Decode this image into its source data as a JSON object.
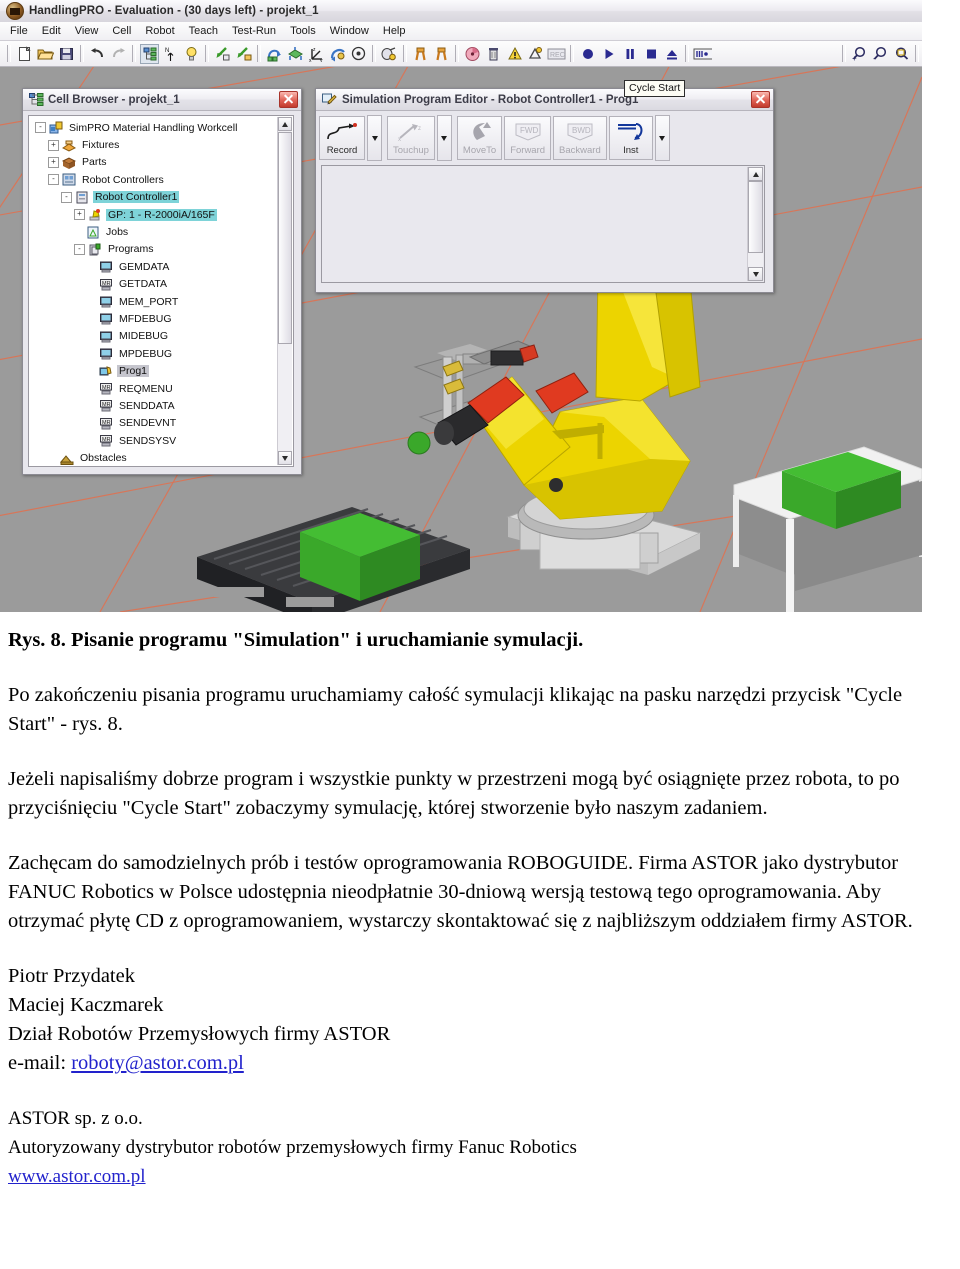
{
  "app": {
    "title": "HandlingPRO - Evaluation - (30 days left) - projekt_1",
    "app_icon": "handlingpro-logo-icon",
    "menu": [
      "File",
      "Edit",
      "View",
      "Cell",
      "Robot",
      "Teach",
      "Test-Run",
      "Tools",
      "Window",
      "Help"
    ],
    "toolbar": {
      "groups": [
        {
          "buttons": [
            {
              "name": "new-icon",
              "glyph": "page"
            },
            {
              "name": "open-icon",
              "glyph": "folder"
            },
            {
              "name": "save-icon",
              "glyph": "floppy"
            }
          ]
        },
        {
          "buttons": [
            {
              "name": "undo-icon",
              "glyph": "undo"
            },
            {
              "name": "redo-icon",
              "glyph": "redo"
            }
          ]
        },
        {
          "buttons": [
            {
              "name": "cell-browser-icon",
              "glyph": "tree",
              "active": true
            },
            {
              "name": "navigator-icon",
              "glyph": "north"
            },
            {
              "name": "hint-icon",
              "glyph": "bulb"
            }
          ]
        },
        {
          "buttons": [
            {
              "name": "teach-tool-icon",
              "glyph": "arrow-green-lock"
            },
            {
              "name": "teach-user-icon",
              "glyph": "arrow-green-user"
            }
          ]
        },
        {
          "buttons": [
            {
              "name": "jog-coord-icon",
              "glyph": "jog"
            },
            {
              "name": "world-frame-icon",
              "glyph": "frame"
            },
            {
              "name": "axis-frame-icon",
              "glyph": "axes"
            },
            {
              "name": "tool-frame-icon",
              "glyph": "toolframe"
            },
            {
              "name": "target-icon",
              "glyph": "target"
            }
          ]
        },
        {
          "buttons": [
            {
              "name": "teach-pendant-icon",
              "glyph": "pendant"
            }
          ]
        },
        {
          "buttons": [
            {
              "name": "gripper-icon",
              "glyph": "gripper"
            },
            {
              "name": "gripper2-icon",
              "glyph": "gripper2"
            }
          ]
        },
        {
          "buttons": [
            {
              "name": "profiler-icon",
              "glyph": "profiler"
            },
            {
              "name": "trash-icon",
              "glyph": "trash"
            },
            {
              "name": "alarm-icon",
              "glyph": "alarm"
            },
            {
              "name": "collision-icon",
              "glyph": "collision"
            },
            {
              "name": "record-display-icon",
              "glyph": "reclabel"
            }
          ]
        },
        {
          "buttons": [
            {
              "name": "record-button-icon",
              "glyph": "record"
            },
            {
              "name": "cycle-start-icon",
              "glyph": "play"
            },
            {
              "name": "pause-icon",
              "glyph": "pause"
            },
            {
              "name": "stop-icon",
              "glyph": "stop"
            },
            {
              "name": "eject-icon",
              "glyph": "eject"
            }
          ]
        },
        {
          "buttons": [
            {
              "name": "timeline-icon",
              "glyph": "timeline"
            }
          ]
        },
        {
          "buttons": [
            {
              "name": "zoom-in-icon",
              "glyph": "zoomin"
            },
            {
              "name": "zoom-out-icon",
              "glyph": "zoomout"
            },
            {
              "name": "zoom-window-icon",
              "glyph": "zoomwin"
            }
          ]
        }
      ]
    },
    "tooltip": "Cycle Start"
  },
  "cell_browser": {
    "title": "Cell Browser - projekt_1",
    "title_icon": "cell-browser-icon",
    "close_label": "Close",
    "tree": [
      {
        "label": "SimPRO Material Handling Workcell",
        "indent": 0,
        "expander": "-",
        "icon": "workcell-icon",
        "state": "none"
      },
      {
        "label": "Fixtures",
        "indent": 1,
        "expander": "+",
        "icon": "fixtures-icon",
        "state": "none"
      },
      {
        "label": "Parts",
        "indent": 1,
        "expander": "+",
        "icon": "parts-icon",
        "state": "none"
      },
      {
        "label": "Robot Controllers",
        "indent": 1,
        "expander": "-",
        "icon": "controllers-icon",
        "state": "none"
      },
      {
        "label": "Robot Controller1",
        "indent": 2,
        "expander": "-",
        "icon": "controller-icon",
        "state": "selected"
      },
      {
        "label": "GP: 1 - R-2000iA/165F",
        "indent": 3,
        "expander": "+",
        "icon": "robot-icon",
        "state": "selected"
      },
      {
        "label": "Jobs",
        "indent": 3,
        "expander": "",
        "icon": "jobs-icon",
        "state": "none"
      },
      {
        "label": "Programs",
        "indent": 3,
        "expander": "-",
        "icon": "programs-icon",
        "state": "none"
      },
      {
        "label": "GEMDATA",
        "indent": 4,
        "expander": "",
        "icon": "program-icon",
        "state": "none"
      },
      {
        "label": "GETDATA",
        "indent": 4,
        "expander": "",
        "icon": "mr-program-icon",
        "state": "none"
      },
      {
        "label": "MEM_PORT",
        "indent": 4,
        "expander": "",
        "icon": "program-icon",
        "state": "none"
      },
      {
        "label": "MFDEBUG",
        "indent": 4,
        "expander": "",
        "icon": "program-icon",
        "state": "none"
      },
      {
        "label": "MIDEBUG",
        "indent": 4,
        "expander": "",
        "icon": "program-icon",
        "state": "none"
      },
      {
        "label": "MPDEBUG",
        "indent": 4,
        "expander": "",
        "icon": "program-icon",
        "state": "none"
      },
      {
        "label": "Prog1",
        "indent": 4,
        "expander": "",
        "icon": "sim-program-icon",
        "state": "focused"
      },
      {
        "label": "REQMENU",
        "indent": 4,
        "expander": "",
        "icon": "mr-program-icon",
        "state": "none"
      },
      {
        "label": "SENDDATA",
        "indent": 4,
        "expander": "",
        "icon": "mr-program-icon",
        "state": "none"
      },
      {
        "label": "SENDEVNT",
        "indent": 4,
        "expander": "",
        "icon": "mr-program-icon",
        "state": "none"
      },
      {
        "label": "SENDSYSV",
        "indent": 4,
        "expander": "",
        "icon": "mr-program-icon",
        "state": "none"
      },
      {
        "label": "Obstacles",
        "indent": 1,
        "expander": "",
        "icon": "obstacles-icon",
        "state": "none"
      }
    ]
  },
  "program_editor": {
    "title": "Simulation Program Editor - Robot Controller1 - Prog1",
    "title_icon": "program-editor-icon",
    "buttons": [
      {
        "label": "Record",
        "icon": "record-point-icon",
        "enabled": true,
        "dropdown": true
      },
      {
        "label": "Touchup",
        "icon": "touchup-icon",
        "enabled": false,
        "dropdown": true
      },
      {
        "label": "MoveTo",
        "icon": "moveto-icon",
        "enabled": false,
        "dropdown": false
      },
      {
        "label": "Forward",
        "icon": "forward-fwd-icon",
        "enabled": false,
        "dropdown": false
      },
      {
        "label": "Backward",
        "icon": "backward-bwd-icon",
        "enabled": false,
        "dropdown": false
      },
      {
        "label": "Inst",
        "icon": "instruction-icon",
        "enabled": true,
        "dropdown": true
      }
    ],
    "forward_badge": "FWD",
    "backward_badge": "BWD",
    "editor_content": ""
  },
  "scene": {
    "background_color": "#9b9b9b",
    "grid_color": "#e06a4c",
    "robot_color": "#ecd400",
    "part_color": "#3aa82a",
    "pallet_color": "#2f3033",
    "table_color": "#f2f2f2"
  },
  "document": {
    "figure_caption": "Rys. 8. Pisanie programu \"Simulation\" i uruchamianie symulacji.",
    "para1": "Po zakończeniu pisania programu uruchamiamy całość symulacji klikając na pasku narzędzi przycisk \"Cycle Start\" - rys. 8.",
    "para2": "Jeżeli napisaliśmy dobrze program i wszystkie punkty w przestrzeni mogą być osiągnięte przez robota, to po przyciśnięciu \"Cycle Start\" zobaczymy symulację, której stworzenie było naszym zadaniem.",
    "para3": "Zachęcam do samodzielnych prób i testów oprogramowania ROBOGUIDE. Firma ASTOR jako dystrybutor FANUC Robotics w Polsce udostępnia nieodpłatnie 30-dniową wersją testową tego oprogramowania. Aby otrzymać płytę CD z oprogramowaniem, wystarczy skontaktować się z najbliższym oddziałem firmy ASTOR.",
    "signature": {
      "name1": "Piotr Przydatek",
      "name2": "Maciej Kaczmarek",
      "department": "Dział Robotów Przemysłowych firmy ASTOR",
      "email_label": "e-mail: ",
      "email": "roboty@astor.com.pl"
    },
    "footer": {
      "company": "ASTOR sp. z o.o.",
      "line2": "Autoryzowany dystrybutor robotów przemysłowych firmy Fanuc Robotics",
      "website": "www.astor.com.pl"
    }
  }
}
